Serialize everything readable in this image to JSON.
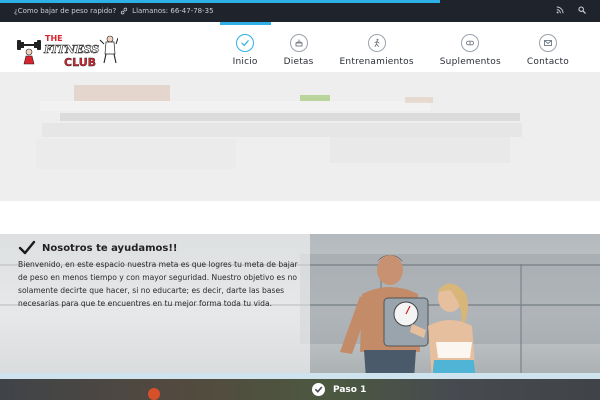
{
  "topbar": {
    "tagline": "¿Como bajar de peso rapido?",
    "phone": "Llamanos: 66-47-78-35",
    "icons": [
      "link-icon",
      "rss-icon",
      "search-icon"
    ]
  },
  "logo": {
    "line1": "THE",
    "line2": "FITNESS",
    "line3": "CLUB"
  },
  "nav": {
    "items": [
      {
        "label": "Inicio",
        "icon": "check-circle-icon",
        "active": true
      },
      {
        "label": "Dietas",
        "icon": "cake-icon",
        "active": false
      },
      {
        "label": "Entrenamientos",
        "icon": "runner-icon",
        "active": false
      },
      {
        "label": "Suplementos",
        "icon": "pill-icon",
        "active": false
      },
      {
        "label": "Contacto",
        "icon": "envelope-icon",
        "active": false
      }
    ]
  },
  "hero": {
    "title": "Nosotros te ayudamos!!",
    "body": "Bienvenido, en este espacio nuestra meta es que logres tu meta de bajar de peso en menos tiempo y con mayor seguridad. Nuestro objetivo es no solamente decirte que hacer, si no educarte; es decir, darte las bases necesarias para que te encuentres en tu mejor forma toda tu vida."
  },
  "stepbar": {
    "label": "Paso 1"
  },
  "colors": {
    "accent": "#2eb0e6",
    "topbar": "#1f242c",
    "logo_red": "#d9232e"
  }
}
